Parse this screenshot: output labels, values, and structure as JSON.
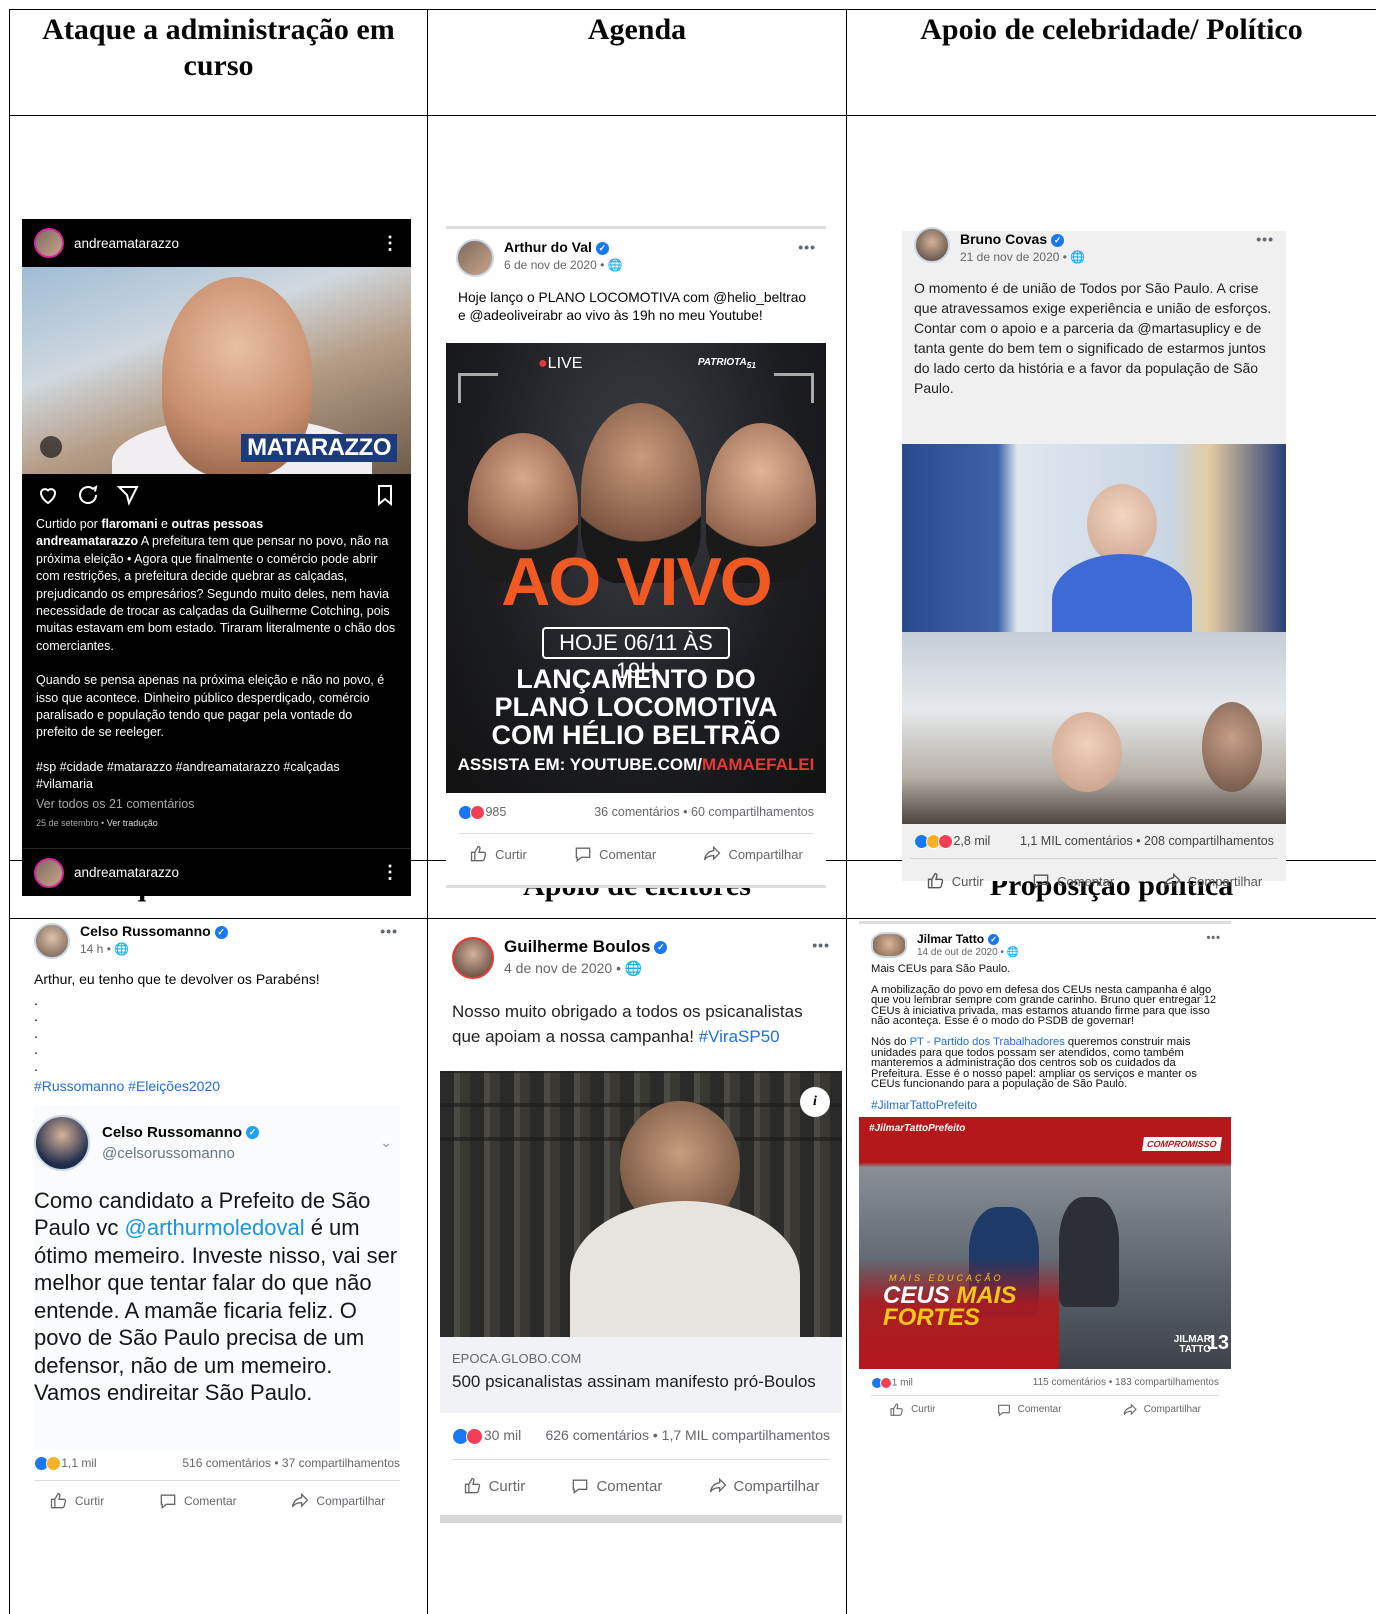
{
  "headers": {
    "c1": "Ataque a administração em curso",
    "c2": "Agenda",
    "c3": "Apoio de celebridade/ Político",
    "c4": "Ataque a adversários",
    "c5": "Apoio de eleitores",
    "c6": "Proposição política"
  },
  "instagram": {
    "username": "andreamatarazzo",
    "overlay_tag": "MATARAZZO",
    "liked_prefix": "Curtido por ",
    "liked_user": "flaromani",
    "liked_mid": " e ",
    "liked_others": "outras pessoas",
    "caption_user": "andreamatarazzo",
    "caption_p1": " A prefeitura tem que pensar no povo, não na próxima eleição • Agora que finalmente o comércio pode abrir com restrições, a prefeitura decide quebrar as calçadas, prejudicando os empresários? Segundo muito deles, nem havia necessidade de trocar as calçadas da Guilherme Cotching, pois muitas estavam em bom estado. Tiraram literalmente o chão dos comerciantes.",
    "caption_p2": "Quando se pensa apenas na próxima eleição e não no povo, é isso que acontece. Dinheiro público desperdiçado, comércio paralisado e população tendo que pagar pela vontade do prefeito de se reeleger.",
    "hashtags": "#sp #cidade #matarazzo #andreamatarazzo #calçadas #vilamaria",
    "comments_link": "Ver todos os 21 comentários",
    "date": "25 de setembro",
    "translate": "Ver tradução",
    "footer_user": "andreamatarazzo"
  },
  "agenda": {
    "name": "Arthur do Val",
    "date": "6 de nov de 2020 • ",
    "text": "Hoje lanço o PLANO LOCOMOTIVA com @helio_beltrao e @adeoliveirabr ao vivo às 19h no meu Youtube!",
    "live": "LIVE",
    "party": "PATRIOTA",
    "party_num": "51",
    "big": "AO VIVO",
    "when": "HOJE 06/11 ÀS 19H",
    "line1": "LANÇAMENTO DO",
    "line2": "PLANO LOCOMOTIVA",
    "line3": "COM HÉLIO BELTRÃO",
    "watch_prefix": "ASSISTA EM: YOUTUBE.COM/",
    "watch_channel": "MAMAEFALEI",
    "reactions": "985",
    "stats": "36 comentários • 60 compartilhamentos",
    "like": "Curtir",
    "comment": "Comentar",
    "share": "Compartilhar"
  },
  "celebrity": {
    "name": "Bruno Covas",
    "date": "21 de nov de 2020 • ",
    "text": "O momento é de união de Todos por São Paulo. A crise que atravessamos exige experiência e união de esforços. Contar com o apoio e a parceria da @martasuplicy e de tanta gente do bem tem o significado de estarmos juntos do lado certo da história e a favor da população de São Paulo.",
    "reactions": "2,8 mil",
    "stats": "1,1 MIL comentários • 208 compartilhamentos",
    "like": "Curtir",
    "comment": "Comentar",
    "share": "Compartilhar"
  },
  "attack": {
    "name": "Celso Russomanno",
    "date": "14 h • ",
    "text": "Arthur, eu tenho que te devolver os Parabéns!",
    "dots": ".",
    "hashtags": "#Russomanno #Eleições2020",
    "tweet_name": "Celso Russomanno",
    "tweet_handle": "@celsorussomanno",
    "tweet_pre": "Como candidato a Prefeito de São Paulo vc ",
    "tweet_mention": "@arthurmoledoval",
    "tweet_post": " é um ótimo memeiro. Investe nisso, vai ser melhor que tentar falar do que não entende. A mamãe ficaria feliz. O povo de São Paulo precisa de um defensor, não de um memeiro. Vamos endireitar São Paulo.",
    "reactions": "1,1 mil",
    "stats": "516 comentários • 37 compartilhamentos",
    "like": "Curtir",
    "comment": "Comentar",
    "share": "Compartilhar"
  },
  "voters": {
    "name": "Guilherme Boulos",
    "date": "4 de nov de 2020 • ",
    "text": "Nosso muito obrigado a todos os psicanalistas que apoiam a nossa campanha! ",
    "hashtag": "#ViraSP50",
    "domain": "EPOCA.GLOBO.COM",
    "headline": "500 psicanalistas assinam manifesto pró-Boulos",
    "reactions": "30 mil",
    "stats": "626 comentários • 1,7 MIL compartilhamentos",
    "like": "Curtir",
    "comment": "Comentar",
    "share": "Compartilhar"
  },
  "proposal": {
    "name": "Jilmar Tatto",
    "date": "14 de out de 2020 • ",
    "p1": "Mais CEUs para São Paulo.",
    "p2": "A mobilização do povo em defesa dos CEUs nesta campanha é algo que vou lembrar sempre com grande carinho. Bruno quer entregar 12 CEUs à iniciativa privada, mas estamos atuando firme para que isso não aconteça. Esse é o modo do PSDB de governar!",
    "p3_pre": "Nós do ",
    "p3_link": "PT - Partido dos Trabalhadores",
    "p3_post": " queremos construir mais unidades para que todos possam ser atendidos, como também manteremos a administração dos centros sob os cuidados da Prefeitura. Esse é o nosso papel: ampliar os serviços e manter os CEUs funcionando para a população de São Paulo.",
    "hashtag": "#JilmarTattoPrefeito",
    "img_tag": "#JilmarTattoPrefeito",
    "badge": "COMPROMISSO",
    "sub": "MAIS EDUCAÇÃO",
    "big1": "CEUS ",
    "big2": "MAIS",
    "big3": "FORTES",
    "brand1": "JILMAR",
    "brand2": "TATTO",
    "brand_num": "13",
    "reactions": "1 mil",
    "stats": "115 comentários • 183 compartilhamentos",
    "like": "Curtir",
    "comment": "Comentar",
    "share": "Compartilhar"
  }
}
